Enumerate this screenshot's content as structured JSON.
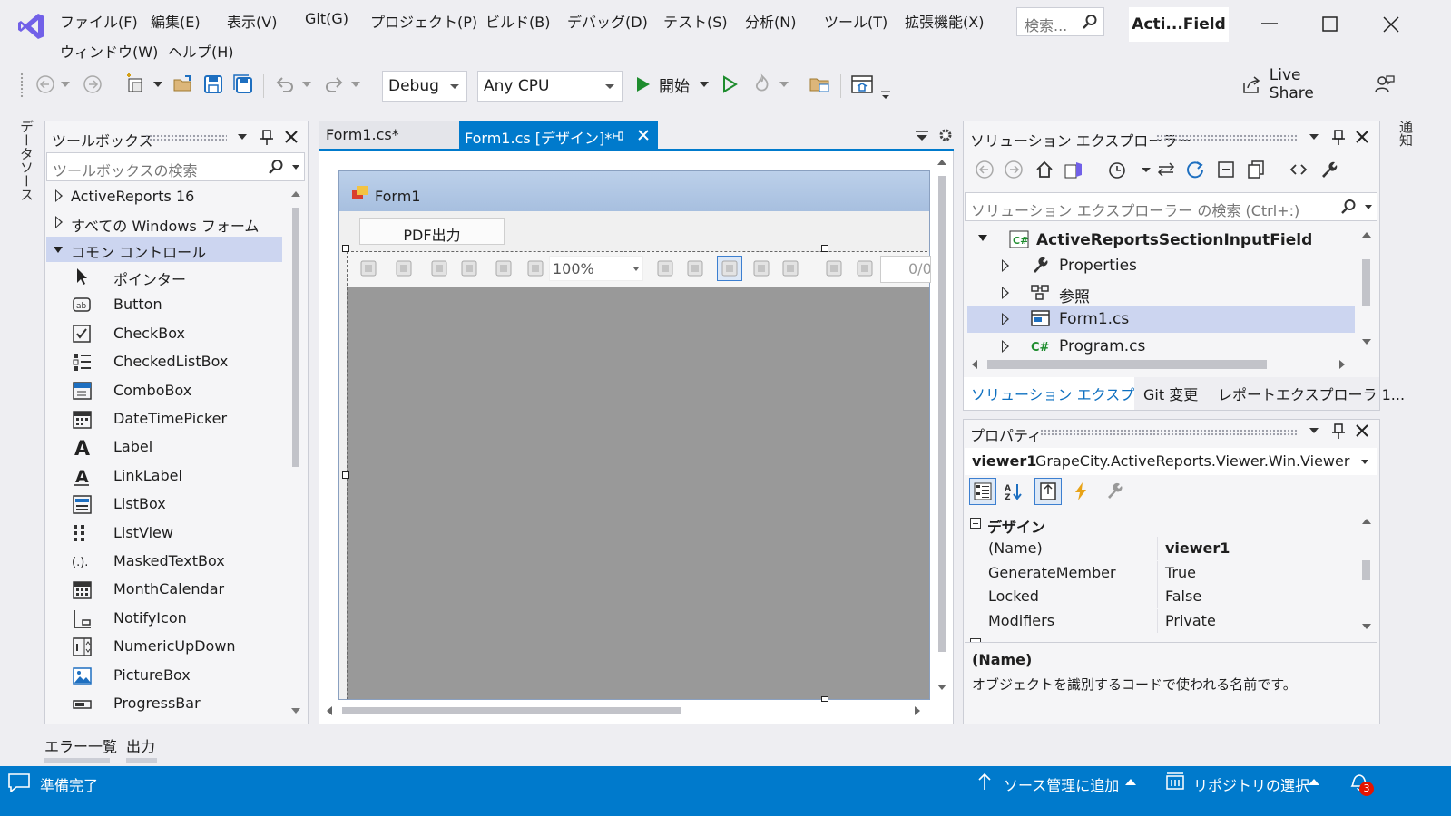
{
  "menu": {
    "items": [
      "ファイル(F)",
      "編集(E)",
      "表示(V)",
      "Git(G)",
      "プロジェクト(P)",
      "ビルド(B)",
      "デバッグ(D)",
      "テスト(S)",
      "分析(N)",
      "ツール(T)",
      "拡張機能(X)"
    ],
    "row2": [
      "ウィンドウ(W)",
      "ヘルプ(H)"
    ],
    "search_placeholder": "検索...",
    "title_badge": "Acti...Field"
  },
  "toolbar": {
    "config": "Debug",
    "platform": "Any CPU",
    "start_label": "開始",
    "live_share": "Live Share"
  },
  "left_strip": {
    "label": "データソース"
  },
  "right_strip": {
    "label": "通知"
  },
  "toolbox": {
    "title": "ツールボックス",
    "search_placeholder": "ツールボックスの検索",
    "groups": [
      "ActiveReports 16",
      "すべての Windows フォーム",
      "コモン コントロール"
    ],
    "items": [
      "ポインター",
      "Button",
      "CheckBox",
      "CheckedListBox",
      "ComboBox",
      "DateTimePicker",
      "Label",
      "LinkLabel",
      "ListBox",
      "ListView",
      "MaskedTextBox",
      "MonthCalendar",
      "NotifyIcon",
      "NumericUpDown",
      "PictureBox",
      "ProgressBar"
    ],
    "icons": [
      "pointer-icon",
      "button-icon",
      "checkbox-icon",
      "checkedlistbox-icon",
      "combobox-icon",
      "datetimepicker-icon",
      "label-icon",
      "linklabel-icon",
      "listbox-icon",
      "listview-icon",
      "maskedtextbox-icon",
      "monthcalendar-icon",
      "notifyicon-icon",
      "numericupdown-icon",
      "picturebox-icon",
      "progressbar-icon"
    ]
  },
  "bottom_tabs": [
    "エラー一覧",
    "出力"
  ],
  "editor": {
    "tabs": [
      "Form1.cs*",
      "Form1.cs [デザイン]*"
    ],
    "form_title": "Form1",
    "pdf_button": "PDF出力",
    "zoom": "100%",
    "page_counter": "0/0"
  },
  "solution_explorer": {
    "title": "ソリューション エクスプローラー",
    "search_placeholder": "ソリューション エクスプローラー の検索 (Ctrl+:)",
    "project": "ActiveReportsSectionInputField",
    "items": [
      "Properties",
      "参照",
      "Form1.cs",
      "Program.cs"
    ],
    "tabs": [
      "ソリューション エクスプロ...",
      "Git 変更",
      "レポートエクスプローラ 1..."
    ]
  },
  "properties": {
    "title": "プロパティ",
    "object_name": "viewer1",
    "object_type": "GrapeCity.ActiveReports.Viewer.Win.Viewer",
    "category": "デザイン",
    "rows": [
      {
        "name": "(Name)",
        "value": "viewer1"
      },
      {
        "name": "GenerateMember",
        "value": "True"
      },
      {
        "name": "Locked",
        "value": "False"
      },
      {
        "name": "Modifiers",
        "value": "Private"
      }
    ],
    "desc_title": "(Name)",
    "desc_text": "オブジェクトを識別するコードで使われる名前です。"
  },
  "status": {
    "ready": "準備完了",
    "source_control": "ソース管理に追加",
    "repository": "リポジトリの選択",
    "notifications": "3"
  },
  "colors": {
    "accent": "#007acc",
    "vs_purple": "#7160e8",
    "selection": "#ccd5f0",
    "status_bar": "#007acc"
  }
}
